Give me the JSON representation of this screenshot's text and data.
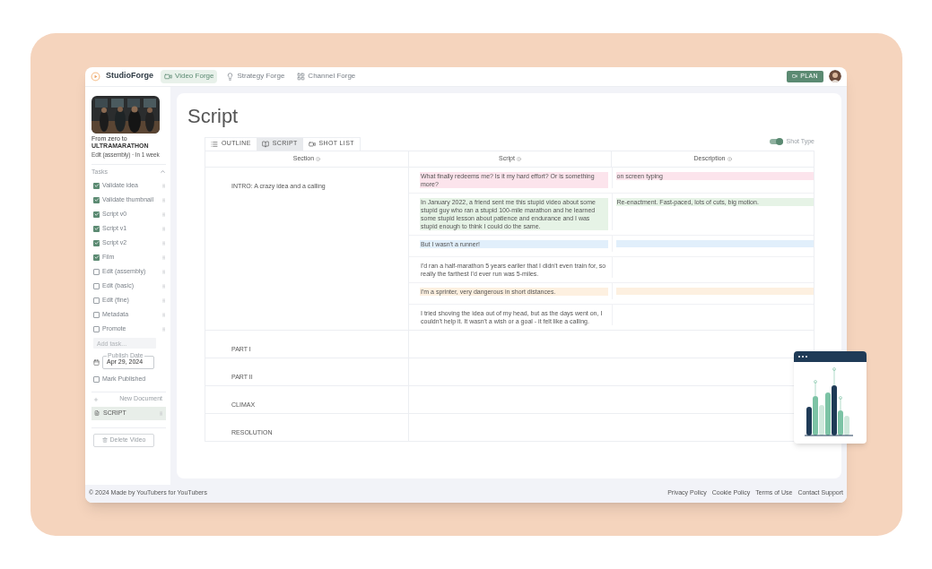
{
  "app": {
    "name": "StudioForge"
  },
  "nav": [
    {
      "label": "Video Forge",
      "selected": true,
      "kind": "video"
    },
    {
      "label": "Strategy Forge",
      "selected": false,
      "kind": "bulb"
    },
    {
      "label": "Channel Forge",
      "selected": false,
      "kind": "grid"
    }
  ],
  "plan_button": "PLAN",
  "video": {
    "kind": "picture",
    "subtitle": "From zero to",
    "title": "ULTRAMARATHON",
    "status": "Edit (assembly) · In 1 week"
  },
  "tasks": {
    "heading": "Tasks",
    "expanded": true,
    "items": [
      {
        "label": "Validate idea",
        "checked": true
      },
      {
        "label": "Validate thumbnail",
        "checked": true
      },
      {
        "label": "Script v0",
        "checked": true
      },
      {
        "label": "Script v1",
        "checked": true
      },
      {
        "label": "Script v2",
        "checked": true
      },
      {
        "label": "Film",
        "checked": true
      },
      {
        "label": "Edit (assembly)",
        "checked": false
      },
      {
        "label": "Edit (basic)",
        "checked": false
      },
      {
        "label": "Edit (fine)",
        "checked": false
      },
      {
        "label": "Metadata",
        "checked": false
      },
      {
        "label": "Promote",
        "checked": false
      }
    ],
    "add_placeholder": "Add task..."
  },
  "publish_date": {
    "label": "Publish Date",
    "value": "Apr 29, 2024"
  },
  "mark_published": {
    "label": "Mark Published",
    "checked": false
  },
  "new_document": "New Document",
  "documents": [
    {
      "label": "SCRIPT",
      "selected": true
    }
  ],
  "delete_button": "Delete Video",
  "page_title": "Script",
  "view_tabs": [
    {
      "label": "OUTLINE",
      "selected": false,
      "kind": "list"
    },
    {
      "label": "SCRIPT",
      "selected": true,
      "kind": "script"
    },
    {
      "label": "SHOT LIST",
      "selected": false,
      "kind": "video"
    }
  ],
  "shot_type_toggle": {
    "label": "Shot Type",
    "on": true
  },
  "table": {
    "columns": [
      "Section",
      "Script",
      "Description"
    ],
    "sections": [
      {
        "title": "INTRO: A crazy idea and a calling",
        "rows": [
          {
            "script": "What finally redeems me? Is it my hard effort? Or is something more?",
            "description": "on screen typing",
            "color": "#fce4ec"
          },
          {
            "script": "In January 2022, a friend sent me this stupid video about some stupid guy who ran a stupid 100-mile marathon and he learned some stupid lesson about patience and endurance and I was stupid enough to think I could do the same.",
            "description": "Re-enactment. Fast-paced, lots of cuts, big motion.",
            "color": "#e6f3e6"
          },
          {
            "script": "But I wasn't a runner!",
            "color": "#e1effb"
          },
          {
            "script": "I'd ran a half-marathon 5 years earlier that I didn't even train for, so really the farthest I'd ever run was 5-miles."
          },
          {
            "script": "I'm a sprinter, very dangerous in short distances.",
            "color": "#fdf0e0"
          },
          {
            "script": "I tried shoving the idea out of my head, but as the days went on, I couldn't help it. It wasn't a wish or a goal - it felt like a calling."
          }
        ]
      },
      {
        "title": "PART I"
      },
      {
        "title": "PART II"
      },
      {
        "title": "CLIMAX"
      },
      {
        "title": "RESOLUTION"
      }
    ]
  },
  "footer": {
    "copyright": "© 2024 Made by YouTubers for YouTubers",
    "links": [
      "Privacy Policy",
      "Cookie Policy",
      "Terms of Use",
      "Contact Support"
    ]
  }
}
